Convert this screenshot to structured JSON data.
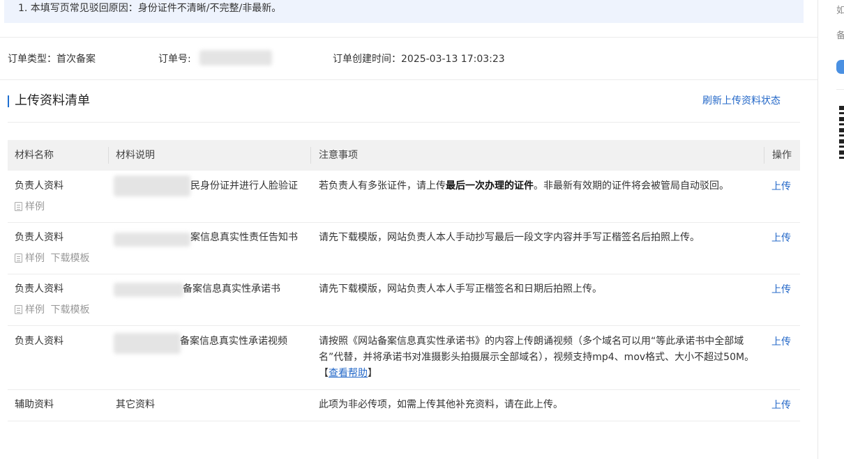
{
  "notice": "1. 本填写页常见驳回原因：身份证件不清晰/不完整/非最新。",
  "order": {
    "type_label": "订单类型：首次备案",
    "number_label": "订单号:",
    "created_label": "订单创建时间：2025-03-13 17:03:23"
  },
  "section": {
    "title": "上传资料清单",
    "refresh": "刷新上传资料状态"
  },
  "table": {
    "headers": [
      "材料名称",
      "材料说明",
      "注意事项",
      "操作"
    ],
    "rows": [
      {
        "name": "负责人资料",
        "desc": "民身份证并进行人脸验证",
        "sample": "样例",
        "template": "",
        "note_pre": "若负责人有多张证件，请上传",
        "note_bold": "最后一次办理的证件",
        "note_post": "。非最新有效期的证件将会被管局自动驳回。",
        "action": "上传"
      },
      {
        "name": "负责人资料",
        "desc": "案信息真实性责任告知书",
        "sample": "样例",
        "template": "下载模板",
        "note": "请先下载模版，网站负责人本人手动抄写最后一段文字内容并手写正楷签名后拍照上传。",
        "action": "上传"
      },
      {
        "name": "负责人资料",
        "desc": "备案信息真实性承诺书",
        "sample": "样例",
        "template": "下载模板",
        "note": "请先下载模版，网站负责人本人手写正楷签名和日期后拍照上传。",
        "action": "上传"
      },
      {
        "name": "负责人资料",
        "desc": "备案信息真实性承诺视频",
        "note_pre": "请按照《网站备案信息真实性承诺书》的内容上传朗诵视频（多个域名可以用“等此承诺书中全部域名”代替，并将承诺书对准摄影头拍摄展示全部域名），视频支持mp4、mov格式、大小不超过50M。【",
        "note_link": "查看帮助",
        "note_post": "】",
        "action": "上传"
      },
      {
        "name": "辅助资料",
        "desc": "其它资料",
        "note": "此项为非必传项，如需上传其他补充资料，请在此上传。",
        "action": "上传"
      }
    ]
  },
  "right_panel": {
    "text1": "如",
    "text2": "备"
  }
}
